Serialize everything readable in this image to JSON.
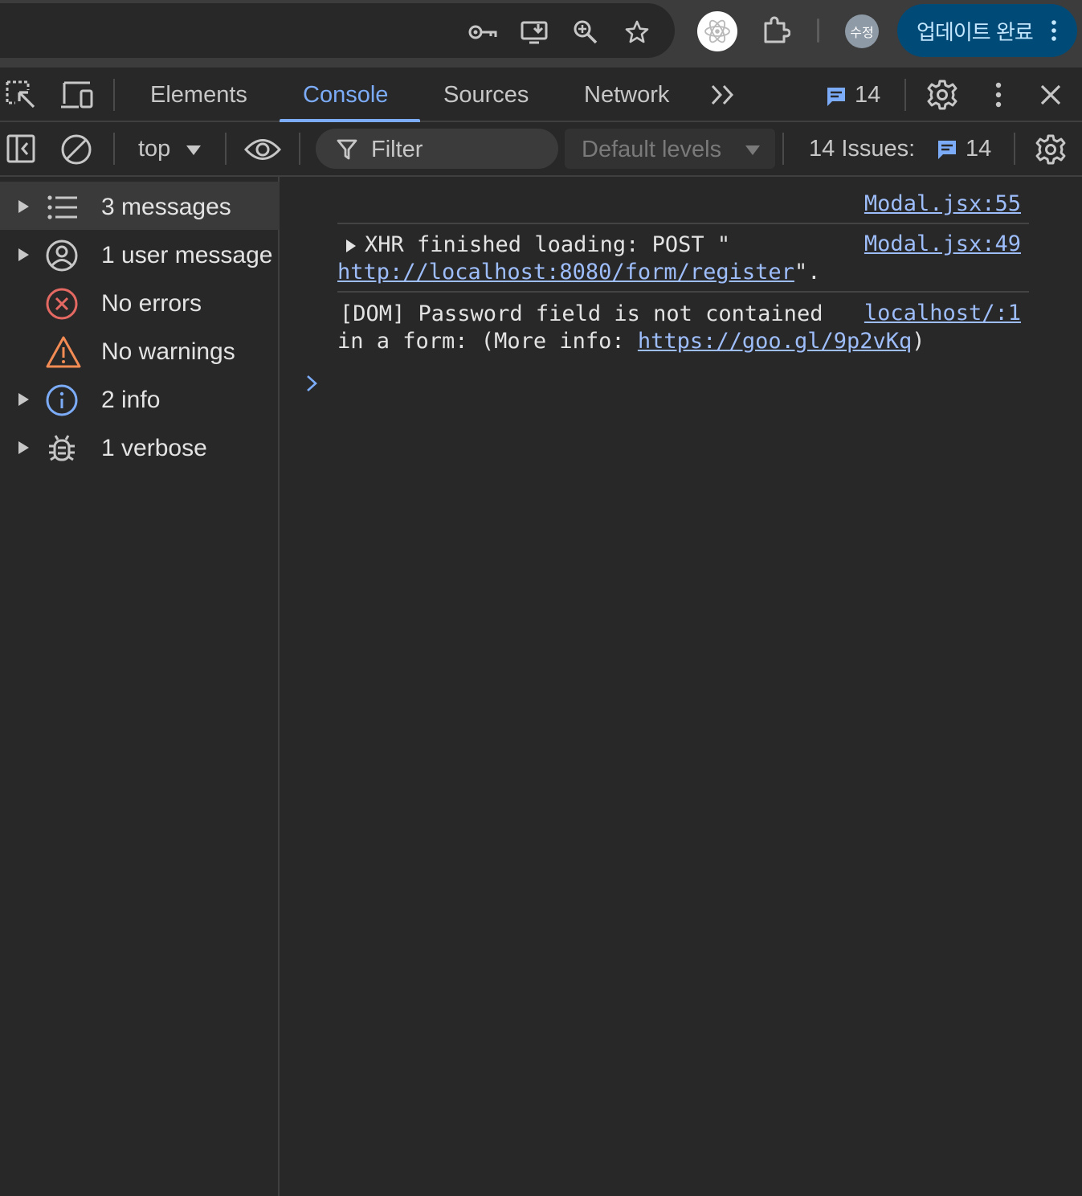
{
  "browser": {
    "profile_label": "수정",
    "update_button_label": "업데이트 완료",
    "icons": [
      "key-icon",
      "install-app-icon",
      "zoom-icon",
      "bookmark-star-icon",
      "react-devtools-icon",
      "extensions-icon",
      "more-vert-icon"
    ]
  },
  "devtools": {
    "tabs": [
      {
        "label": "Elements",
        "active": false
      },
      {
        "label": "Console",
        "active": true
      },
      {
        "label": "Sources",
        "active": false
      },
      {
        "label": "Network",
        "active": false
      }
    ],
    "issues_badge_count": "14"
  },
  "toolbar": {
    "context": "top",
    "filter_placeholder": "Filter",
    "levels": "Default levels",
    "issues_label": "14 Issues:",
    "issues_count": "14"
  },
  "sidebar": {
    "items": [
      {
        "label": "3 messages",
        "icon": "list-icon"
      },
      {
        "label": "1 user message",
        "icon": "user-icon"
      },
      {
        "label": "No errors",
        "icon": "error-icon"
      },
      {
        "label": "No warnings",
        "icon": "warning-icon"
      },
      {
        "label": "2 info",
        "icon": "info-icon"
      },
      {
        "label": "1 verbose",
        "icon": "bug-icon"
      }
    ]
  },
  "console": {
    "messages": [
      {
        "source": "Modal.jsx:55"
      },
      {
        "source": "Modal.jsx:49",
        "prefix": "XHR finished loading: POST \"",
        "url": "http://localhost:8080/form/register",
        "suffix": "\"."
      },
      {
        "source": "localhost/:1",
        "line1": "[DOM] Password field is not contained",
        "line2_prefix": "in a form: (More info: ",
        "url": "https://goo.gl/9p2vKq",
        "line2_suffix": ")"
      }
    ]
  },
  "colors": {
    "accent": "#7cacf8",
    "link": "#9ebdfb",
    "error": "#e46962",
    "warning": "#f28b54",
    "update_button_bg": "#004a77"
  }
}
